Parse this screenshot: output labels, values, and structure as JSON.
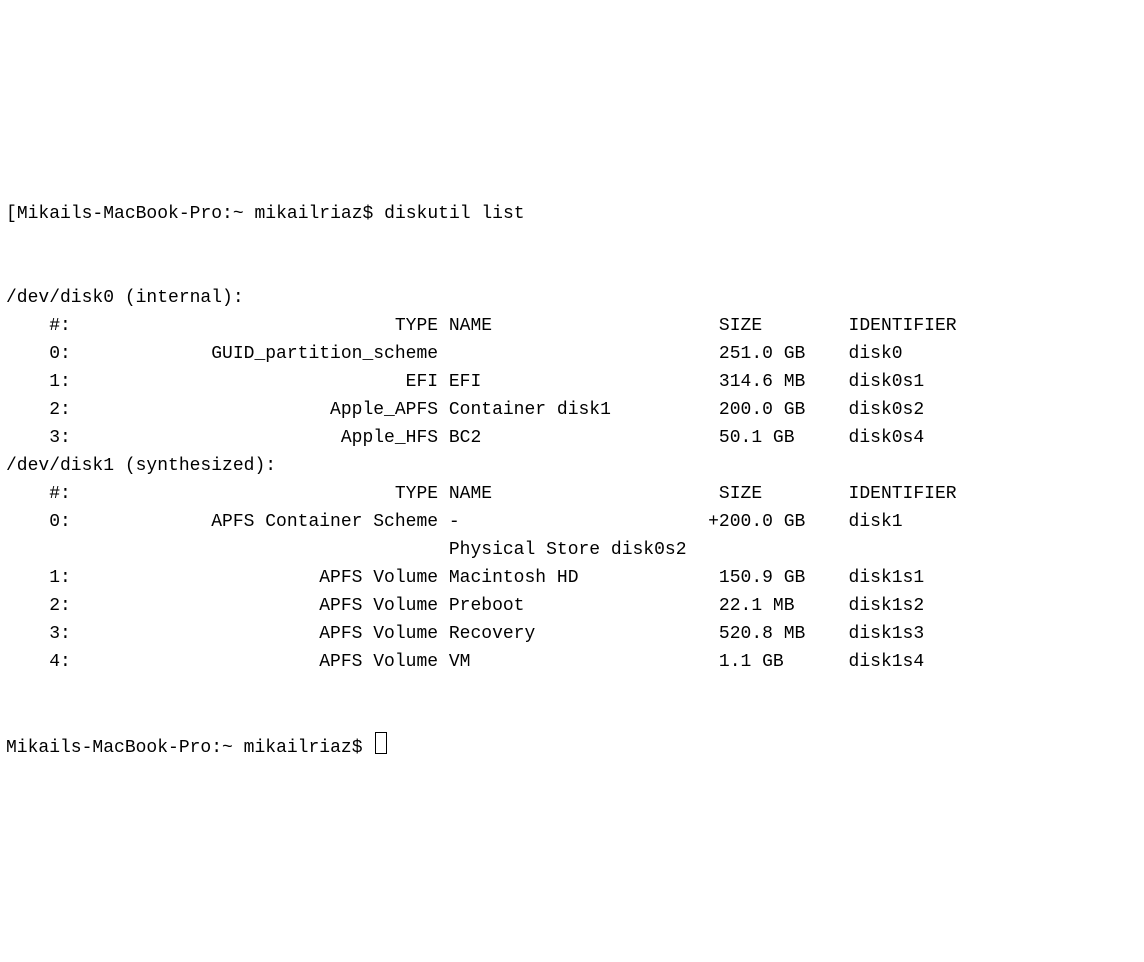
{
  "prompt1": {
    "bracket": "[",
    "host": "Mikails-MacBook-Pro",
    "sep1": ":",
    "cwd": "~",
    "user": "mikailriaz",
    "sigil": "$",
    "command": "diskutil list"
  },
  "sections": [
    {
      "device": "/dev/disk0",
      "note": "(internal):",
      "header": {
        "num": "#:",
        "type": "TYPE",
        "name": "NAME",
        "size": "SIZE",
        "ident": "IDENTIFIER"
      },
      "rows": [
        {
          "num": "0:",
          "type": "GUID_partition_scheme",
          "name": "",
          "size_prefix": " ",
          "size": "251.0 GB",
          "ident": "disk0"
        },
        {
          "num": "1:",
          "type": "EFI",
          "name": "EFI",
          "size_prefix": " ",
          "size": "314.6 MB",
          "ident": "disk0s1"
        },
        {
          "num": "2:",
          "type": "Apple_APFS",
          "name": "Container disk1",
          "size_prefix": " ",
          "size": "200.0 GB",
          "ident": "disk0s2"
        },
        {
          "num": "3:",
          "type": "Apple_HFS",
          "name": "BC2",
          "size_prefix": " ",
          "size": "50.1 GB",
          "ident": "disk0s4"
        }
      ]
    },
    {
      "device": "/dev/disk1",
      "note": "(synthesized):",
      "header": {
        "num": "#:",
        "type": "TYPE",
        "name": "NAME",
        "size": "SIZE",
        "ident": "IDENTIFIER"
      },
      "rows": [
        {
          "num": "0:",
          "type": "APFS Container Scheme",
          "name": "-",
          "size_prefix": "+",
          "size": "200.0 GB",
          "ident": "disk1"
        },
        {
          "extra_name": "Physical Store disk0s2"
        },
        {
          "num": "1:",
          "type": "APFS Volume",
          "name": "Macintosh HD",
          "size_prefix": " ",
          "size": "150.9 GB",
          "ident": "disk1s1"
        },
        {
          "num": "2:",
          "type": "APFS Volume",
          "name": "Preboot",
          "size_prefix": " ",
          "size": "22.1 MB",
          "ident": "disk1s2"
        },
        {
          "num": "3:",
          "type": "APFS Volume",
          "name": "Recovery",
          "size_prefix": " ",
          "size": "520.8 MB",
          "ident": "disk1s3"
        },
        {
          "num": "4:",
          "type": "APFS Volume",
          "name": "VM",
          "size_prefix": " ",
          "size": "1.1 GB",
          "ident": "disk1s4"
        }
      ]
    }
  ],
  "prompt2": {
    "host": "Mikails-MacBook-Pro",
    "sep1": ":",
    "cwd": "~",
    "user": "mikailriaz",
    "sigil": "$"
  }
}
